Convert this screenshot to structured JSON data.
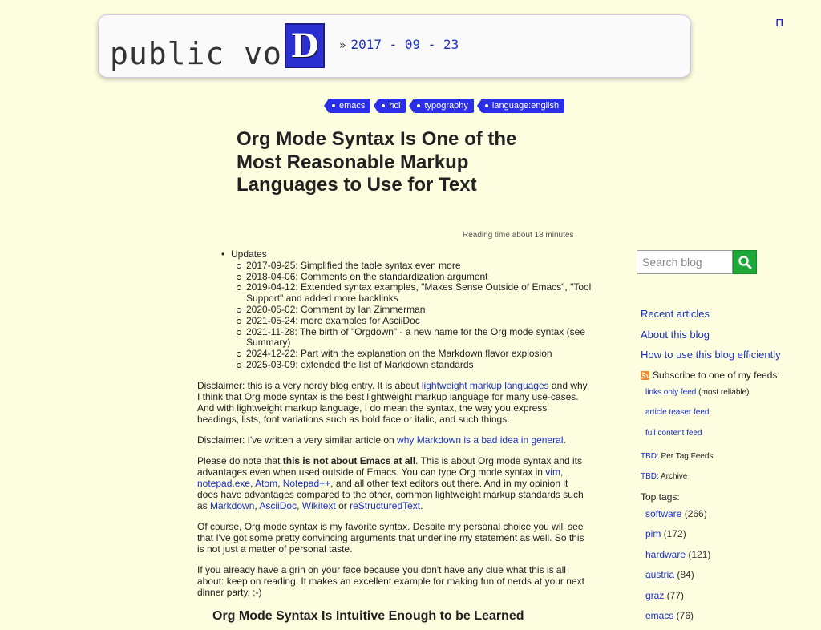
{
  "header": {
    "site_title": "public voi",
    "logo_letter": "D",
    "raquo": "»",
    "date": "2017 - 09 - 23",
    "corner_glyph": "п"
  },
  "tags": [
    "emacs",
    "hci",
    "typography",
    "language:english"
  ],
  "article": {
    "title": "Org Mode Syntax Is One of the Most Reasonable Markup Languages to Use for Text",
    "reading_time": "Reading time about 18 minutes",
    "updates_label": "Updates",
    "updates": [
      "2017-09-25: Simplified the table syntax even more",
      "2018-04-06: Comments on the standardization argument",
      "2019-04-12: Extended syntax examples, \"Makes Sense Outside of Emacs\", \"Tool Support\" and added more backlinks",
      "2020-05-02: Comment by Ian Zimmerman",
      "2021-05-24: more examples for AsciiDoc",
      "2021-11-28: The birth of \"Orgdown\" - a new name for the Org mode syntax (see Summary)",
      "2024-12-22: Part with the explanation on the Markdown flavor explosion",
      "2025-03-09: extended the list of Markdown standards"
    ],
    "p1": {
      "pre": "Disclaimer: this is a very nerdy blog entry. It is about ",
      "link": "lightweight markup languages",
      "post": " and why I think that Org mode syntax is the best lightweight markup language for many use-cases. And with lightweight markup language, I do mean the syntax, the way you express headings, lists, font variations such as bold face or italic, and such things."
    },
    "p2": {
      "pre": "Disclaimer: I've written a very similar article on ",
      "link": "why Markdown is a bad idea in general",
      "post": "."
    },
    "p3": {
      "t1": "Please do note that ",
      "bold": "this is not about Emacs at all",
      "t2": ". This is about Org mode syntax and its advantages even when used outside of Emacs. You can type Org mode syntax in ",
      "l_vim": "vim",
      "c1": ", ",
      "l_notepad": "notepad.exe",
      "c2": ", ",
      "l_atom": "Atom",
      "c3": ", ",
      "l_npp": "Notepad++",
      "t3": ", and all other text editors out there. And in my opinion it does have advantages compared to the other, common lightweight markup standards such as ",
      "l_md": "Markdown",
      "c4": ", ",
      "l_ad": "AsciiDoc",
      "c5": ", ",
      "l_wt": "Wikitext",
      "t4": " or ",
      "l_rst": "reStructuredText",
      "t5": "."
    },
    "p4": "Of course, Org mode syntax is my favorite syntax. Despite my personal choice you will see that I've got some pretty convincing arguments that underline my statement as well. So this is not just a matter of personal taste.",
    "p5": "If you already have a grin on your face because you don't have any clue what this is all about: keep on reading. It makes an excellent example for making fun of nerds at your next dinner party. ;-)",
    "next_heading": "Org Mode Syntax Is Intuitive Enough to be Learned"
  },
  "sidebar": {
    "search_placeholder": "Search blog",
    "links": [
      "Recent articles",
      "About this blog",
      "How to use this blog efficiently"
    ],
    "feeds_heading": "Subscribe to one of my feeds:",
    "feeds": [
      {
        "link": "links only feed",
        "note": " (most reliable)"
      },
      {
        "link": "article teaser feed",
        "note": ""
      },
      {
        "link": "full content feed",
        "note": ""
      }
    ],
    "tbd1": {
      "label": "TBD:",
      "text": " Per Tag Feeds"
    },
    "tbd2": {
      "label": "TBD:",
      "text": " Archive"
    },
    "top_tags_label": "Top tags:",
    "top_tags": [
      {
        "name": "software",
        "count": " (266)"
      },
      {
        "name": "pim",
        "count": " (172)"
      },
      {
        "name": "hardware",
        "count": " (121)"
      },
      {
        "name": "austria",
        "count": " (84)"
      },
      {
        "name": "graz",
        "count": " (77)"
      },
      {
        "name": "emacs",
        "count": " (76)"
      }
    ]
  },
  "colors": {
    "background": "#fdfde0",
    "link": "#1a30c4",
    "tag_bg": "#2a2ee8",
    "search_btn": "#1ea83a"
  }
}
